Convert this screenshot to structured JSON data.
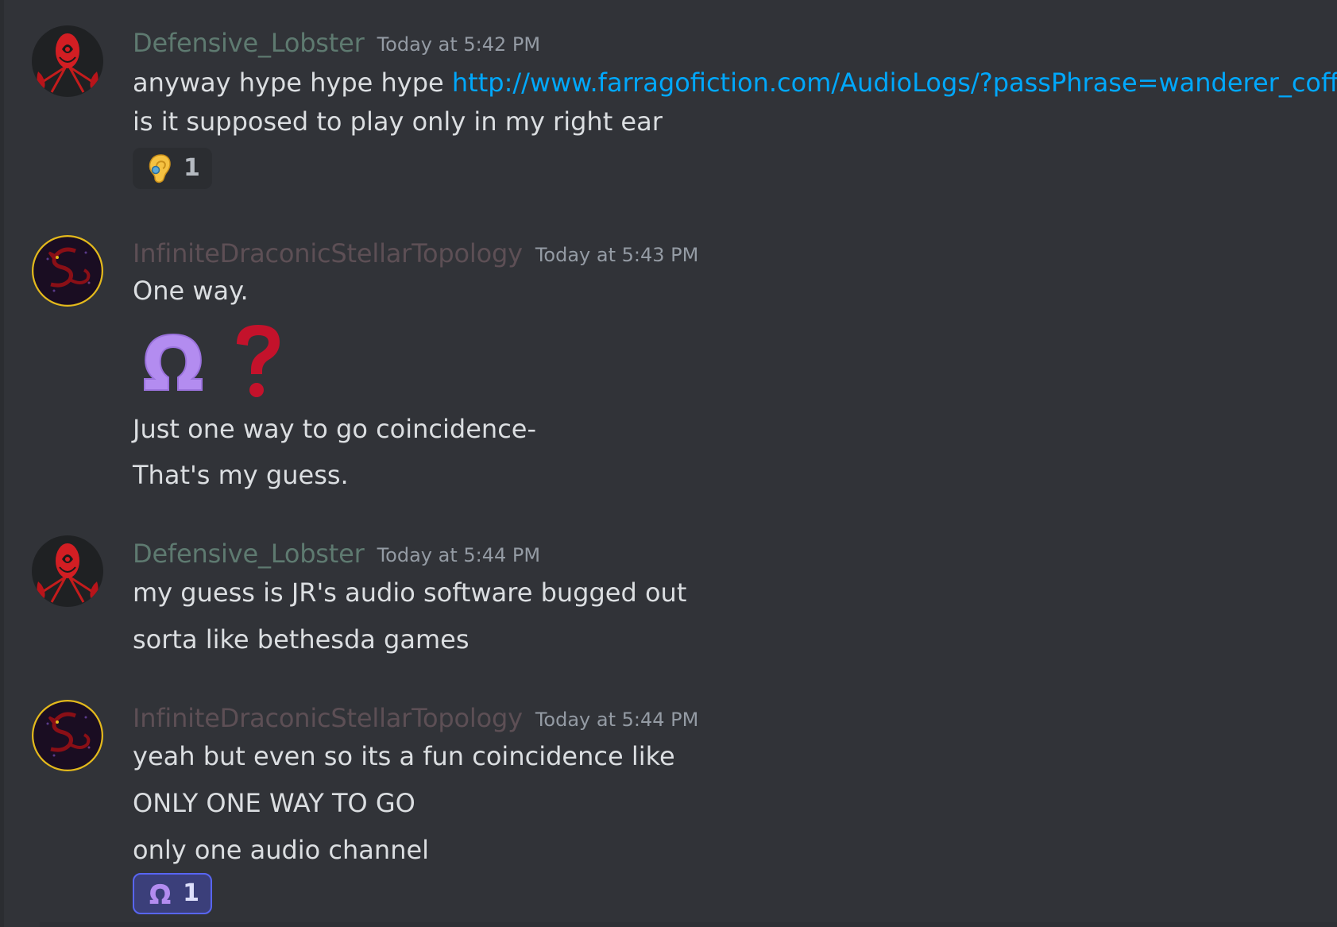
{
  "messages": [
    {
      "author": "Defensive_Lobster",
      "timestamp": "Today at 5:42 PM",
      "lines": [
        {
          "text": "anyway hype hype hype ",
          "link": "http://www.farragofiction.com/AudioLogs/?passPhrase=wanderer_coffin"
        },
        {
          "text": "is it supposed to play only in my right ear"
        }
      ],
      "reaction": {
        "emoji": "ear-emoji",
        "count": "1"
      }
    },
    {
      "author": "InfiniteDraconicStellarTopology",
      "timestamp": "Today at 5:43 PM",
      "lines": [
        {
          "text": "One way."
        },
        {
          "text": "Just one way to go coincidence-"
        },
        {
          "text": "That's my guess."
        }
      ],
      "big_emojis": [
        "omega-emoji",
        "red-question-mark-emoji"
      ]
    },
    {
      "author": "Defensive_Lobster",
      "timestamp": "Today at 5:44 PM",
      "lines": [
        {
          "text": "my guess is JR's audio software bugged out"
        },
        {
          "text": "sorta like bethesda games"
        }
      ]
    },
    {
      "author": "InfiniteDraconicStellarTopology",
      "timestamp": "Today at 5:44 PM",
      "lines": [
        {
          "text": "yeah but even so its a fun coincidence like"
        },
        {
          "text": "ONLY ONE WAY TO GO"
        },
        {
          "text": "only one audio channel"
        }
      ],
      "reaction": {
        "emoji": "omega-emoji",
        "count": "1"
      }
    }
  ],
  "colors": {
    "background": "#313338",
    "lobster_name": "#5e7a70",
    "dragon_name": "#5d4f55",
    "link": "#00a8fc",
    "timestamp": "#949ba4"
  }
}
